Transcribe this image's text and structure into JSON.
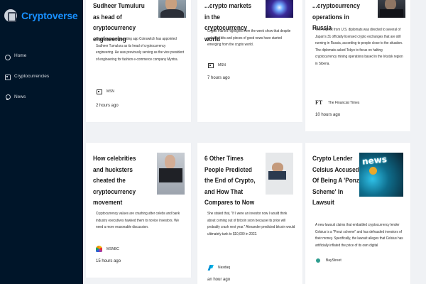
{
  "app": {
    "name": "Cryptoverse"
  },
  "nav": [
    {
      "label": "Home"
    },
    {
      "label": "Cryptocurrencies"
    },
    {
      "label": "News"
    }
  ],
  "cards": [
    {
      "title": "Sudheer Tumuluru as head of cryptocurrency engineering",
      "description": "Cryptocurrency investing app Coinswitch has appointed Sudheer Tumuluru as its head of cryptocurrency engineering. He was previously serving as the vice president of engineering for fashion e-commerce company Myntra.",
      "provider": "MSN",
      "time": "2 hours ago"
    },
    {
      "title": "...crypto markets in the cryptocurrency world",
      "description": "Crypto market highlights from the week show that despite volatility, bits and pieces of good news have started emerging from the crypto world.",
      "provider": "MSN",
      "time": "7 hours ago"
    },
    {
      "title": "...cryptocurrency operations in Russia",
      "description": "The request from U.S. diplomats was directed to several of Japan's 31 officially licensed crypto exchanges that are still running in Russia, according to people close to the situation. The diplomats asked Tokyo to focus on halting cryptocurrency mining operations based in the Irkutsk region in Siberia.",
      "provider": "The Financial Times",
      "provider_icon": "FT",
      "time": "10 hours ago"
    },
    {
      "title": "How celebrities and hucksters cheated the cryptocurrency movement",
      "description": "Cryptocurrency values are crashing after celebs and bank industry executives hawked them to novice investors. We need a more reasonable discussion.",
      "provider": "MSNBC",
      "time": "15 hours ago"
    },
    {
      "title": "6 Other Times People Predicted the End of Crypto, and How That Compares to Now",
      "description": "She stated that, \"If I were an investor now I would think about coming out of bitcoin soon because its price will probably crash next year.\" Alexander predicted bitcoin would ultimately tank to $10,000 in 2022.",
      "provider": "Nasdaq",
      "time": "an hour ago"
    },
    {
      "title": "Crypto Lender Celsius Accused Of Being A 'Ponzi Scheme' In Lawsuit",
      "description": "A new lawsuit claims that embattled cryptocurrency lender Celsius is a \"Ponzi scheme\" and has defrauded investors of their money. Specifically, the lawsuit alleges that Celsius has artificially inflated the price of its own digital",
      "provider": "BayStreet",
      "thumb_text": "news"
    }
  ]
}
